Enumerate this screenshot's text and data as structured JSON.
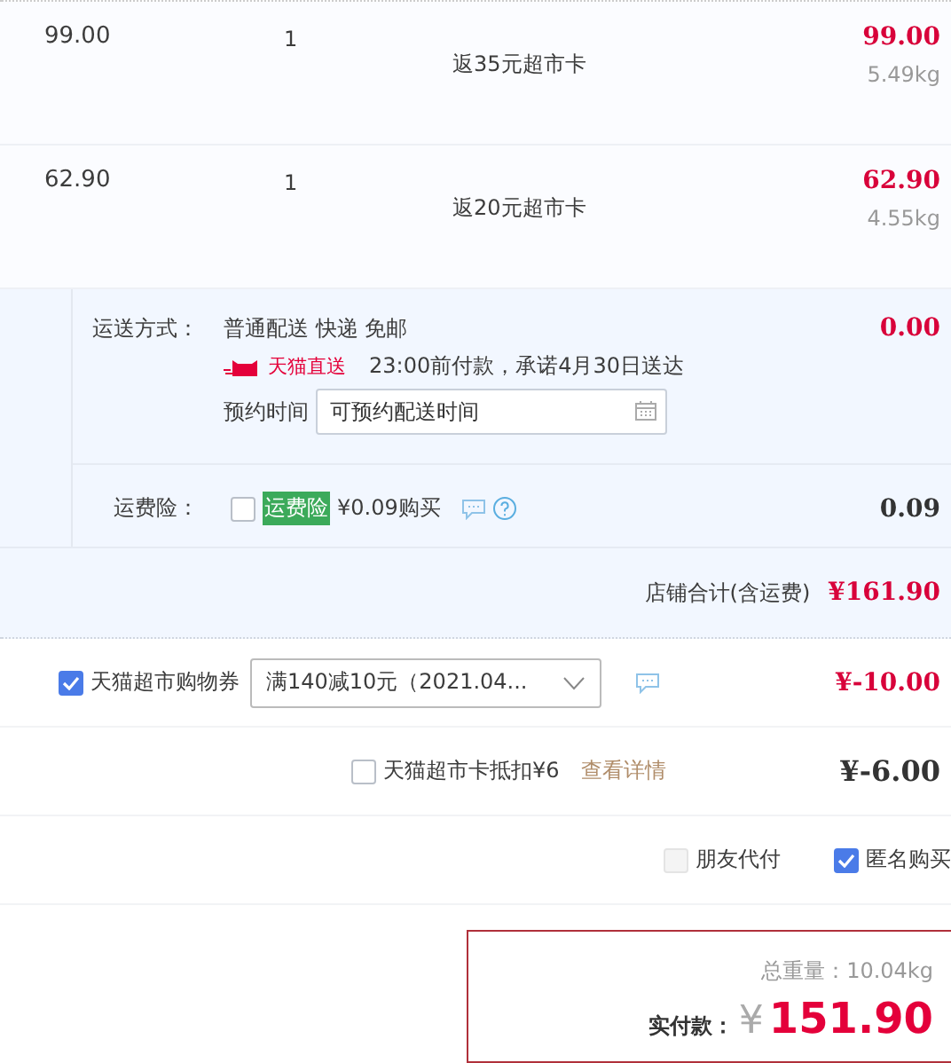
{
  "items": [
    {
      "price": "99.00",
      "quantity": "1",
      "promo": "返35元超市卡",
      "subtotal": "99.00",
      "weight": "5.49kg"
    },
    {
      "price": "62.90",
      "quantity": "1",
      "promo": "返20元超市卡",
      "subtotal": "62.90",
      "weight": "4.55kg"
    }
  ],
  "shipping": {
    "label": "运送方式：",
    "method": "普通配送 快递 免邮",
    "badge": "天猫直送",
    "promise": "23:00前付款，承诺4月30日送达",
    "schedule_label": "预约时间",
    "schedule_placeholder": "可预约配送时间",
    "fee": "0.00"
  },
  "insurance": {
    "label": "运费险：",
    "checked": false,
    "tag": "运费险",
    "price": "¥0.09购买",
    "fee": "0.09"
  },
  "store_total": {
    "label": "店铺合计(含运费)",
    "value": "¥161.90"
  },
  "coupon": {
    "checked": true,
    "label": "天猫超市购物券",
    "value": "满140减10元（2021.04...",
    "amount": "¥-10.00"
  },
  "card": {
    "checked": false,
    "label": "天猫超市卡抵扣¥6",
    "link": "查看详情",
    "amount": "¥-6.00"
  },
  "options": [
    {
      "label": "朋友代付",
      "checked": false,
      "disabled": true
    },
    {
      "label": "匿名购买",
      "checked": true,
      "disabled": false
    }
  ],
  "summary": {
    "weight_label": "总重量：",
    "weight": "10.04kg",
    "pay_label": "实付款：",
    "currency": "¥",
    "total": "151.90"
  }
}
